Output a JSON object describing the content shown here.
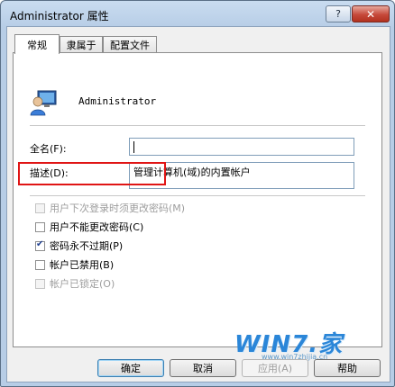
{
  "window": {
    "title": "Administrator 属性",
    "help_label": "?",
    "close_label": "✕"
  },
  "tabs": [
    {
      "label": "常规",
      "active": true
    },
    {
      "label": "隶属于",
      "active": false
    },
    {
      "label": "配置文件",
      "active": false
    }
  ],
  "user": {
    "name": "Administrator",
    "icon": "user-icon"
  },
  "fields": {
    "fullname_label": "全名(F):",
    "fullname_value": "",
    "description_label": "描述(D):",
    "description_value": "管理计算机(域)的内置帐户"
  },
  "checkboxes": [
    {
      "label": "用户下次登录时须更改密码(M)",
      "checked": false,
      "enabled": false
    },
    {
      "label": "用户不能更改密码(C)",
      "checked": false,
      "enabled": true
    },
    {
      "label": "密码永不过期(P)",
      "checked": true,
      "enabled": true
    },
    {
      "label": "帐户已禁用(B)",
      "checked": false,
      "enabled": true
    },
    {
      "label": "帐户已锁定(O)",
      "checked": false,
      "enabled": false
    }
  ],
  "watermark": {
    "text": "WIN7.家",
    "url": "www.win7zhijia.cn"
  },
  "buttons": {
    "ok": "确定",
    "cancel": "取消",
    "apply": "应用(A)",
    "help": "帮助"
  },
  "colors": {
    "highlight_border": "#e01515",
    "title_bar": "#b7cde6",
    "close_button": "#c6493a"
  }
}
